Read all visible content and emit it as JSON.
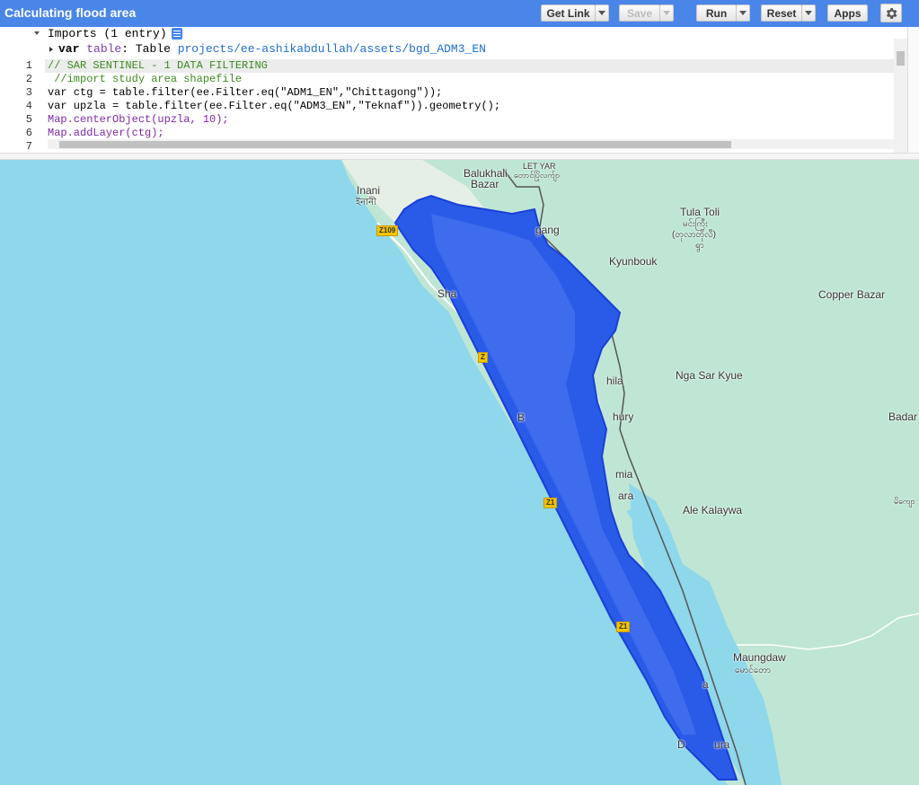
{
  "app": {
    "title": "Calculating flood area"
  },
  "toolbar": {
    "get_link_label": "Get Link",
    "save_label": "Save",
    "run_label": "Run",
    "reset_label": "Reset",
    "apps_label": "Apps"
  },
  "imports": {
    "header": "Imports (1 entry)",
    "entry": {
      "keyword": "var",
      "name": "table",
      "type": "Table",
      "path": "projects/ee-ashikabdullah/assets/bgd_ADM3_EN"
    }
  },
  "editor": {
    "lines": [
      {
        "num": "1",
        "text": "// SAR SENTINEL - 1 DATA FILTERING"
      },
      {
        "num": "2",
        "text": " //import study area shapefile"
      },
      {
        "num": "3",
        "text": "var ctg = table.filter(ee.Filter.eq(\"ADM1_EN\",\"Chittagong\"));"
      },
      {
        "num": "4",
        "text": "var upzla = table.filter(ee.Filter.eq(\"ADM3_EN\",\"Teknaf\")).geometry();"
      },
      {
        "num": "5",
        "text": "Map.centerObject(upzla, 10);"
      },
      {
        "num": "6",
        "text": "Map.addLayer(ctg);"
      },
      {
        "num": "7",
        "text": ""
      }
    ]
  },
  "map": {
    "labels": {
      "inani": "Inani",
      "inani_bn": "ইনানী",
      "balukhali": "Balukhali",
      "bazar": "Bazar",
      "let_yar": "LET YAR",
      "let_yar_my": "တောင်ပြိုလက်ျာ",
      "tula_toli": "Tula Toli",
      "tula_toli_my": "မင်းကြီး",
      "tula_toli_my2": "(တုလာတိုလီ)",
      "tula_toli_my3": "ရွာ",
      "kyunbouk": "Kyunbouk",
      "copper_bazar": "Copper Bazar",
      "nga_sar_kyue": "Nga Sar Kyue",
      "badar": "Badar",
      "ale_kalaywa": "Ale Kalaywa",
      "maungdaw": "Maungdaw",
      "maungdaw_my": "မောင်တော",
      "right_my": "မိကျော",
      "gang": "gang",
      "sha": "Sha",
      "hila": "hila",
      "hury": "hury",
      "mia": "mia",
      "ara": "ara",
      "b": "B",
      "a": "a",
      "dm": "D",
      "ura": "ura"
    },
    "roads": [
      "Z109",
      "Z",
      "Z1",
      "Z1"
    ],
    "colors": {
      "sea": "#8fd7ea",
      "land": "#b9e3cc",
      "land_light": "#e8f0e8",
      "flood_layer": "#2a5be8",
      "flood_dark": "#1a3fd6",
      "road": "#ffffff",
      "border": "#555555",
      "topbar": "#4a86e8"
    }
  }
}
